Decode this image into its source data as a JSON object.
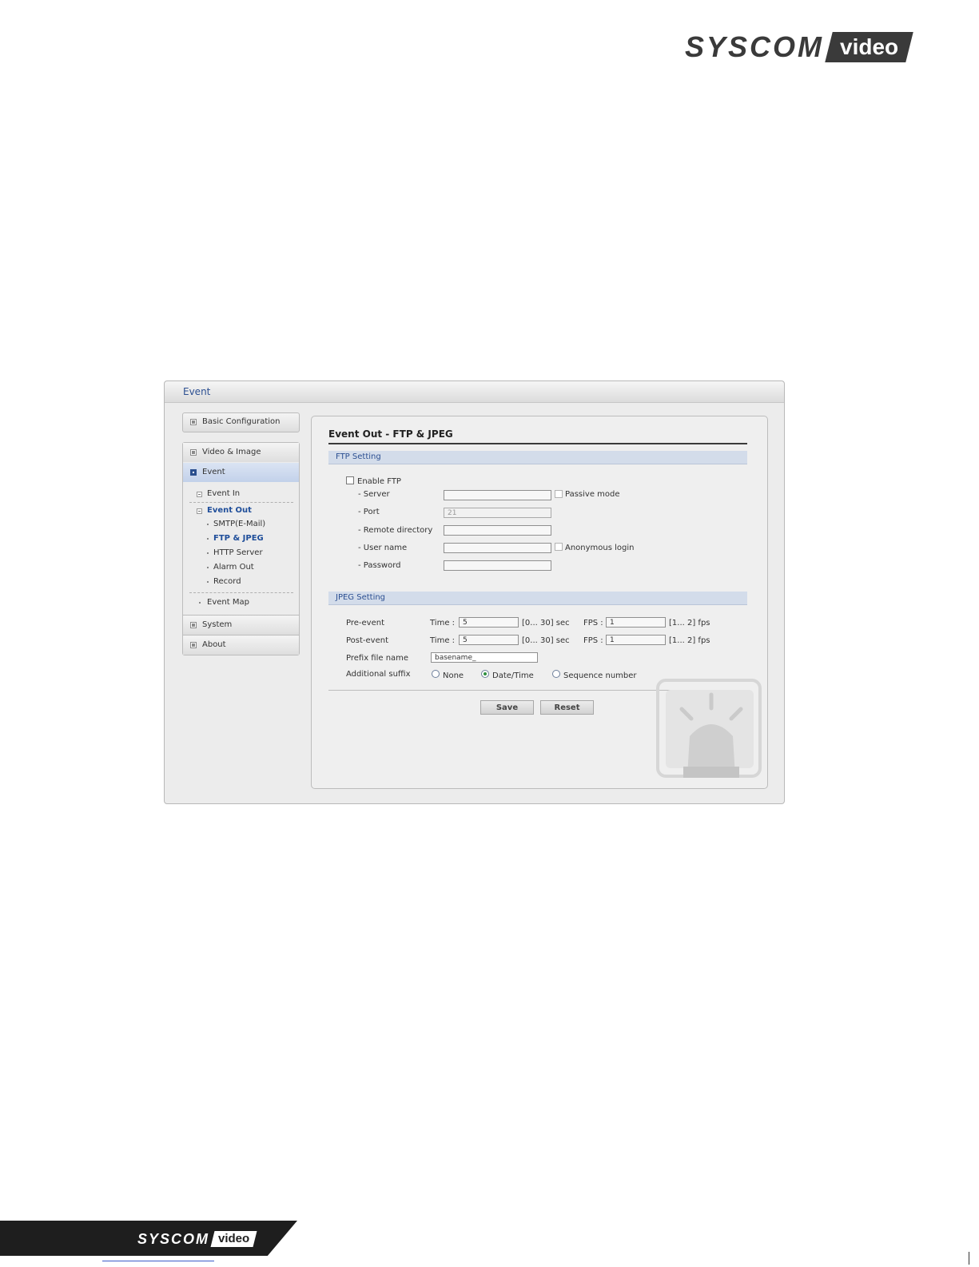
{
  "brand": {
    "logo_text": "SYSCOM",
    "logo_tag": "video"
  },
  "window": {
    "title": "Event"
  },
  "sidebar": {
    "basic_configuration": "Basic Configuration",
    "video_image": "Video & Image",
    "event": "Event",
    "event_in": "Event In",
    "event_out": "Event Out",
    "event_out_items": [
      "SMTP(E-Mail)",
      "FTP & JPEG",
      "HTTP Server",
      "Alarm Out",
      "Record"
    ],
    "event_map": "Event Map",
    "system": "System",
    "about": "About"
  },
  "main": {
    "title": "Event Out - FTP & JPEG",
    "ftp_section": {
      "header": "FTP Setting",
      "enable_ftp_label": "Enable FTP",
      "enable_ftp_checked": false,
      "server_label": "- Server",
      "server_value": "",
      "passive_mode_label": "Passive mode",
      "passive_mode_checked": false,
      "port_label": "- Port",
      "port_value": "21",
      "remote_dir_label": "- Remote directory",
      "remote_dir_value": "",
      "username_label": "- User name",
      "username_value": "",
      "anonymous_login_label": "Anonymous login",
      "anonymous_login_checked": false,
      "password_label": "- Password",
      "password_value": ""
    },
    "jpeg_section": {
      "header": "JPEG Setting",
      "pre_event_label": "Pre-event",
      "post_event_label": "Post-event",
      "time_label": "Time :",
      "fps_label": "FPS :",
      "pre_time_value": "5",
      "pre_time_range": "[0... 30] sec",
      "pre_fps_value": "1",
      "pre_fps_range": "[1... 2] fps",
      "post_time_value": "5",
      "post_time_range": "[0... 30] sec",
      "post_fps_value": "1",
      "post_fps_range": "[1... 2] fps",
      "prefix_label": "Prefix file name",
      "prefix_value": "basename_",
      "suffix_label": "Additional suffix",
      "suffix_options": [
        "None",
        "Date/Time",
        "Sequence number"
      ],
      "suffix_selected": "Date/Time"
    },
    "buttons": {
      "save": "Save",
      "reset": "Reset"
    }
  }
}
